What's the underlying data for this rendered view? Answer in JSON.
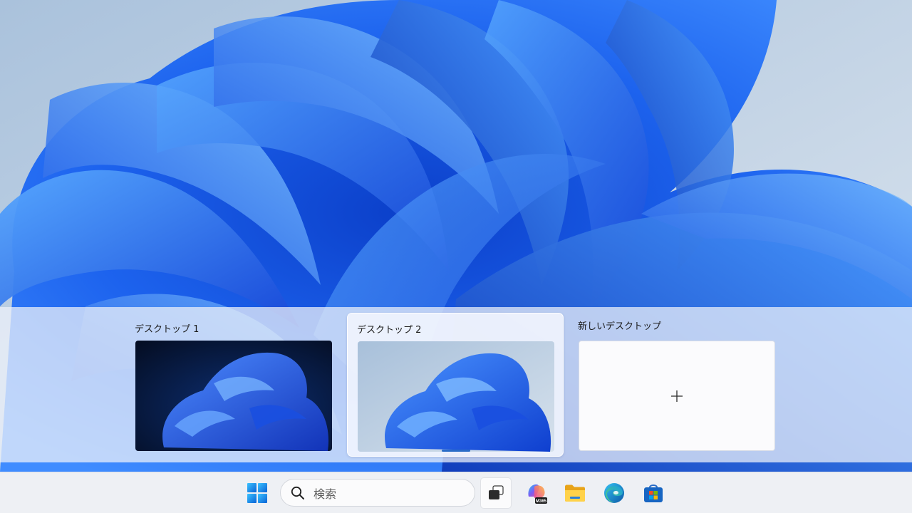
{
  "taskview": {
    "desktops": [
      {
        "label": "デスクトップ 1"
      },
      {
        "label": "デスクトップ 2"
      }
    ],
    "new_desktop_label": "新しいデスクトップ"
  },
  "taskbar": {
    "search_placeholder": "検索",
    "apps": [
      {
        "icon": "start-icon"
      },
      {
        "icon": "task-view-icon"
      },
      {
        "icon": "m365-copilot-icon",
        "badge": "M365"
      },
      {
        "icon": "file-explorer-icon"
      },
      {
        "icon": "edge-icon"
      },
      {
        "icon": "microsoft-store-icon"
      }
    ]
  },
  "colors": {
    "wallpaper_blue": "#1e5fe6",
    "wallpaper_light": "#c6d6e6",
    "accent": "#2a6cc7"
  }
}
